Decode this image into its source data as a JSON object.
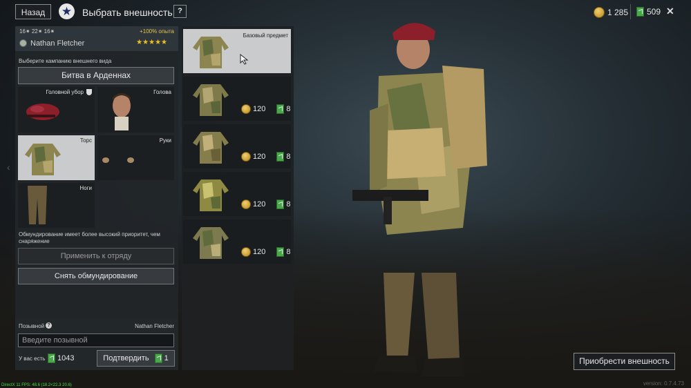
{
  "header": {
    "back_label": "Назад",
    "title": "Выбрать внешность",
    "help_label": "?",
    "gold": "1 285",
    "tickets": "509",
    "close": "✕"
  },
  "profile": {
    "stats": "16⁕  22⁕  16⁕",
    "bonus": "+100% опыта",
    "name": "Nathan Fletcher",
    "rating": "★★★★★"
  },
  "campaign": {
    "label": "Выберите кампанию внешнего вида",
    "selected": "Битва в Арденнах"
  },
  "slots": [
    {
      "label": "Головной убор",
      "icon": "beret"
    },
    {
      "label": "Голова",
      "icon": "head"
    },
    {
      "label": "Торс",
      "icon": "jacket"
    },
    {
      "label": "Руки",
      "icon": "gloves"
    },
    {
      "label": "Ноги",
      "icon": "trousers"
    }
  ],
  "info_text": "Обмундирование имеет более высокий приоритет, чем снаряжение",
  "buttons": {
    "apply_squad": "Применить к отряду",
    "remove_uniform": "Снять обмундирование",
    "confirm": "Подтвердить",
    "confirm_cost": "1",
    "purchase": "Приобрести внешность"
  },
  "callsign": {
    "label": "Позывной",
    "current": "Nathan Fletcher",
    "placeholder": "Введите позывной",
    "have_label": "У вас есть",
    "have_value": "1043"
  },
  "items": [
    {
      "label": "Базовый предмет",
      "gold": "",
      "tickets": ""
    },
    {
      "label": "",
      "gold": "120",
      "tickets": "8"
    },
    {
      "label": "",
      "gold": "120",
      "tickets": "8"
    },
    {
      "label": "",
      "gold": "120",
      "tickets": "8"
    },
    {
      "label": "",
      "gold": "120",
      "tickets": "8"
    }
  ],
  "footer": {
    "version": "version: 0.7.4.73",
    "fps": "DirectX 11 FPS: 48.6 (18.2<22.3 20.6)"
  },
  "colors": {
    "accent_gold": "#f0c020",
    "ticket_green": "#4aa84a",
    "selected_bg": "#c9cbcc"
  }
}
